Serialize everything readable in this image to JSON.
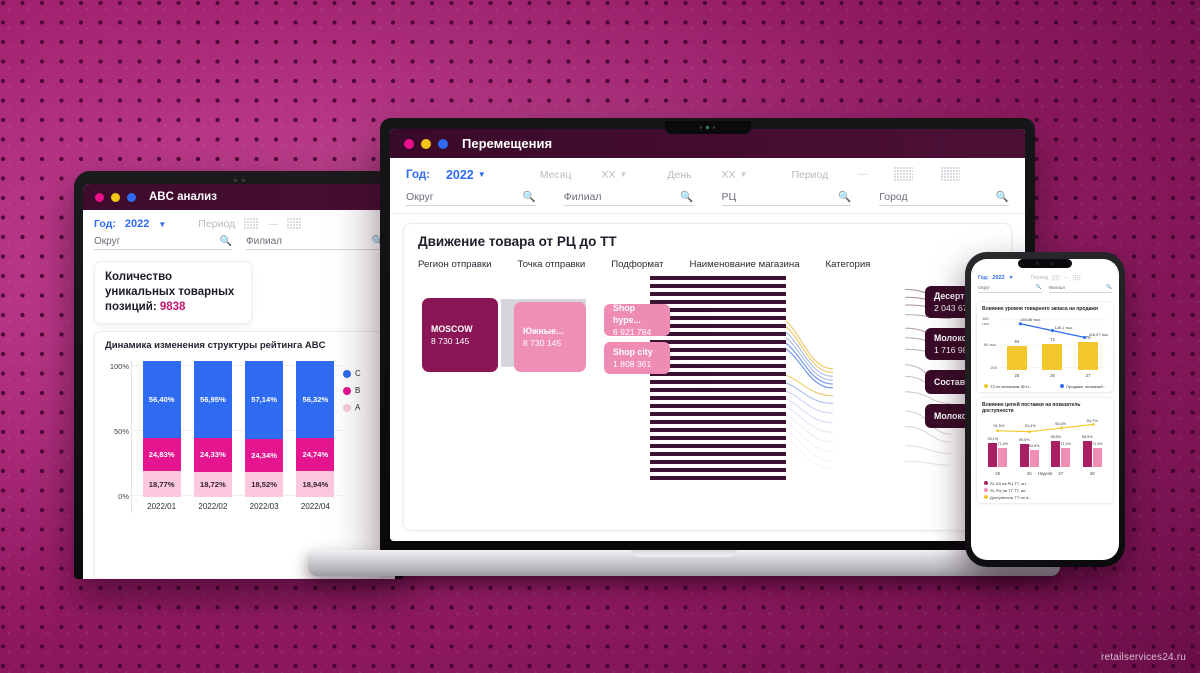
{
  "watermark": "retailservices24.ru",
  "colors": {
    "blue": "#2f6bf0",
    "magenta": "#e5148f",
    "pink_light": "#fbc8dd",
    "deep_purple": "#3a0b28",
    "brand_pink": "#ef8fb6",
    "kpi_number": "#c2166e",
    "yellow": "#f2c72c"
  },
  "tablet": {
    "window_title": "ABC анализ",
    "traffic_lights": [
      "close-dot",
      "minimize-dot",
      "maximize-dot"
    ],
    "filters": {
      "year_label": "Год:",
      "year_value": "2022",
      "period_label": "Период",
      "dash": "—",
      "search_1_placeholder": "Округ",
      "search_2_placeholder": "Филиал"
    },
    "kpi": {
      "text": "Количество уникальных товарных позиций: ",
      "value": "9838"
    },
    "chart_card_title": "Динамика изменения структуры рейтинга ABC"
  },
  "laptop": {
    "window_title": "Перемещения",
    "filters": {
      "year_label": "Год:",
      "year_value": "2022",
      "month_label": "Месяц",
      "month_value": "XX",
      "day_label": "День",
      "day_value": "XX",
      "period_label": "Период",
      "dash": "—",
      "search_1_placeholder": "Округ",
      "search_2_placeholder": "Филиал",
      "search_3_placeholder": "РЦ",
      "search_4_placeholder": "Город"
    },
    "panel_title": "Движение товара от РЦ до ТТ",
    "tabs": [
      "Регион отправки",
      "Точка отправки",
      "Подформат",
      "Наименование магазина",
      "Категория"
    ],
    "sankey": {
      "nodes_left": [
        {
          "label": "MOSCOW",
          "value": "8 730 145"
        }
      ],
      "nodes_mid1": [
        {
          "label": "Южные...",
          "value": "8 730 145"
        }
      ],
      "nodes_mid2": [
        {
          "label": "Shop hype...",
          "value": "6 921 784"
        },
        {
          "label": "Shop city",
          "value": "1 808 361"
        }
      ],
      "nodes_right": [
        {
          "label": "Десерты",
          "value": "2 043 678"
        },
        {
          "label": "Молоко...",
          "value": "1 716 986"
        },
        {
          "label": "Составно...",
          "value": ""
        },
        {
          "label": "Молоко...",
          "value": ""
        }
      ]
    }
  },
  "phone": {
    "filters": {
      "year_label": "Год:",
      "year_value": "2022",
      "period_label": "Период",
      "dash": "—",
      "search_1_placeholder": "Округ",
      "search_2_placeholder": "Филиал"
    },
    "card1_title": "Влияние уровня товарного запаса на продажи",
    "card2_title": "Влияние цепей поставки на показатель доступности"
  },
  "chart_data": [
    {
      "id": "abc-rating-structure",
      "type": "bar",
      "stacked": true,
      "title": "Динамика изменения структуры рейтинга ABC",
      "xlabel": "",
      "ylabel": "",
      "ylim": [
        0,
        100
      ],
      "ytick_labels": [
        "0%",
        "50%",
        "100%"
      ],
      "grid": true,
      "legend_position": "right",
      "categories": [
        "2022/01",
        "2022/02",
        "2022/03",
        "2022/04"
      ],
      "series": [
        {
          "name": "A",
          "color": "#fbc8dd",
          "values": [
            18.77,
            18.72,
            18.52,
            18.94
          ],
          "labels": [
            "18,77%",
            "18,72%",
            "18,52%",
            "18,94%"
          ]
        },
        {
          "name": "B",
          "color": "#e5148f",
          "values": [
            24.83,
            24.33,
            24.34,
            24.74
          ],
          "labels": [
            "24,83%",
            "24,33%",
            "24,34%",
            "24,74%"
          ]
        },
        {
          "name": "C",
          "color": "#2f6bf0",
          "values": [
            56.4,
            56.95,
            57.14,
            56.32
          ],
          "labels": [
            "56,40%",
            "56,95%",
            "57,14%",
            "56,32%"
          ]
        }
      ]
    },
    {
      "id": "stock-impact-on-sales",
      "type": "bar",
      "combo": "line",
      "title": "Влияние уровня товарного запаса на продажи",
      "xlabel": "",
      "ylabel": "",
      "ytick_labels": [
        "200",
        "80 тыс.",
        "160 тыс."
      ],
      "categories": [
        "25",
        "26",
        "27"
      ],
      "series": [
        {
          "name": "ТЗ по активным SKU...",
          "type": "bar",
          "color": "#f2c72c",
          "values": [
            64,
            72,
            79
          ],
          "labels": [
            "64",
            "72",
            "79"
          ]
        },
        {
          "name": "Продажи, активный...",
          "type": "line",
          "color": "#2f6bf0",
          "values": [
            140.86,
            128.1,
            116.07
          ],
          "labels": [
            "140,86 тыс.",
            "128,1 тыс.",
            "116,07 тыс."
          ]
        }
      ]
    },
    {
      "id": "supply-chain-availability",
      "type": "bar",
      "combo": "line",
      "title": "Влияние цепей поставки на показатель доступности",
      "xlabel": "Неделя",
      "ylabel": "",
      "categories": [
        "25",
        "26",
        "27",
        "28"
      ],
      "series": [
        {
          "name": "SL KA на РЦ ТТ, шт",
          "type": "bar",
          "color": "#a81f63",
          "values": [
            93.1,
            89.5,
            98.5,
            98.5
          ],
          "labels": [
            "93,1%",
            "89,5%",
            "98,5%",
            "98,5%"
          ]
        },
        {
          "name": "SL РЦ на ТТ ТТ, шт",
          "type": "bar",
          "color": "#ef8fb6",
          "values": [
            71.9,
            62.8,
            71.3,
            71.3
          ],
          "labels": [
            "71,9%",
            "62,8%",
            "71,3%",
            "71,3%"
          ]
        },
        {
          "name": "Доступность ТТ по а...",
          "type": "line",
          "color": "#f2c72c",
          "values": [
            91.5,
            91.4,
            92.6,
            94.7
          ],
          "labels": [
            "91,5%",
            "91,4%",
            "92,6%",
            "94,7%"
          ]
        }
      ]
    }
  ]
}
